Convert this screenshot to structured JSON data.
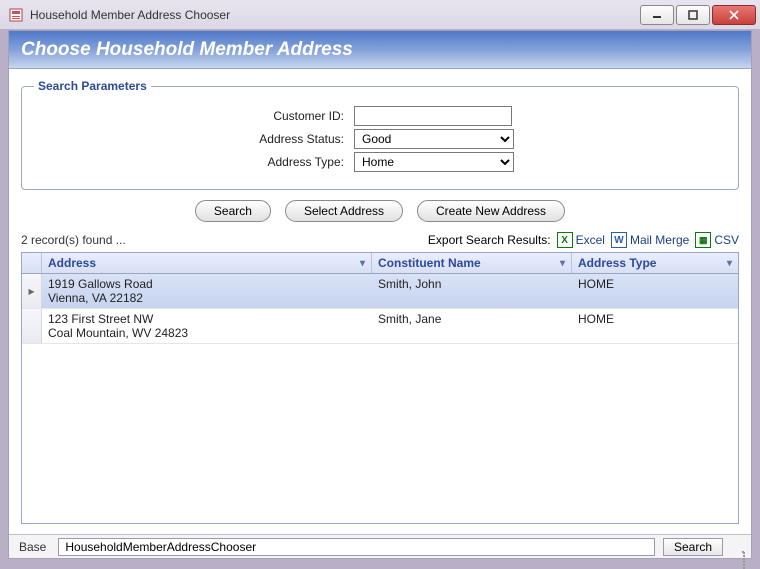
{
  "window": {
    "title": "Household Member Address Chooser"
  },
  "header": {
    "title": "Choose Household Member Address"
  },
  "searchParams": {
    "legend": "Search Parameters",
    "customerId": {
      "label": "Customer ID:",
      "value": ""
    },
    "addressStatus": {
      "label": "Address Status:",
      "value": "Good"
    },
    "addressType": {
      "label": "Address Type:",
      "value": "Home"
    }
  },
  "buttons": {
    "search": "Search",
    "selectAddress": "Select Address",
    "createNewAddress": "Create New Address"
  },
  "results": {
    "countText": "2 record(s) found ...",
    "exportLabel": "Export Search Results:",
    "exportExcel": "Excel",
    "exportMailMerge": "Mail Merge",
    "exportCsv": "CSV"
  },
  "grid": {
    "columns": {
      "address": "Address",
      "constituentName": "Constituent Name",
      "addressType": "Address Type"
    },
    "rows": [
      {
        "addressLine1": "1919 Gallows Road",
        "addressLine2": "Vienna, VA 22182",
        "constituentName": "Smith, John",
        "addressType": "HOME",
        "selected": true
      },
      {
        "addressLine1": "123 First Street NW",
        "addressLine2": "Coal Mountain, WV 24823",
        "constituentName": "Smith, Jane",
        "addressType": "HOME",
        "selected": false
      }
    ]
  },
  "status": {
    "baseLabel": "Base",
    "path": "HouseholdMemberAddressChooser",
    "searchBtn": "Search"
  }
}
